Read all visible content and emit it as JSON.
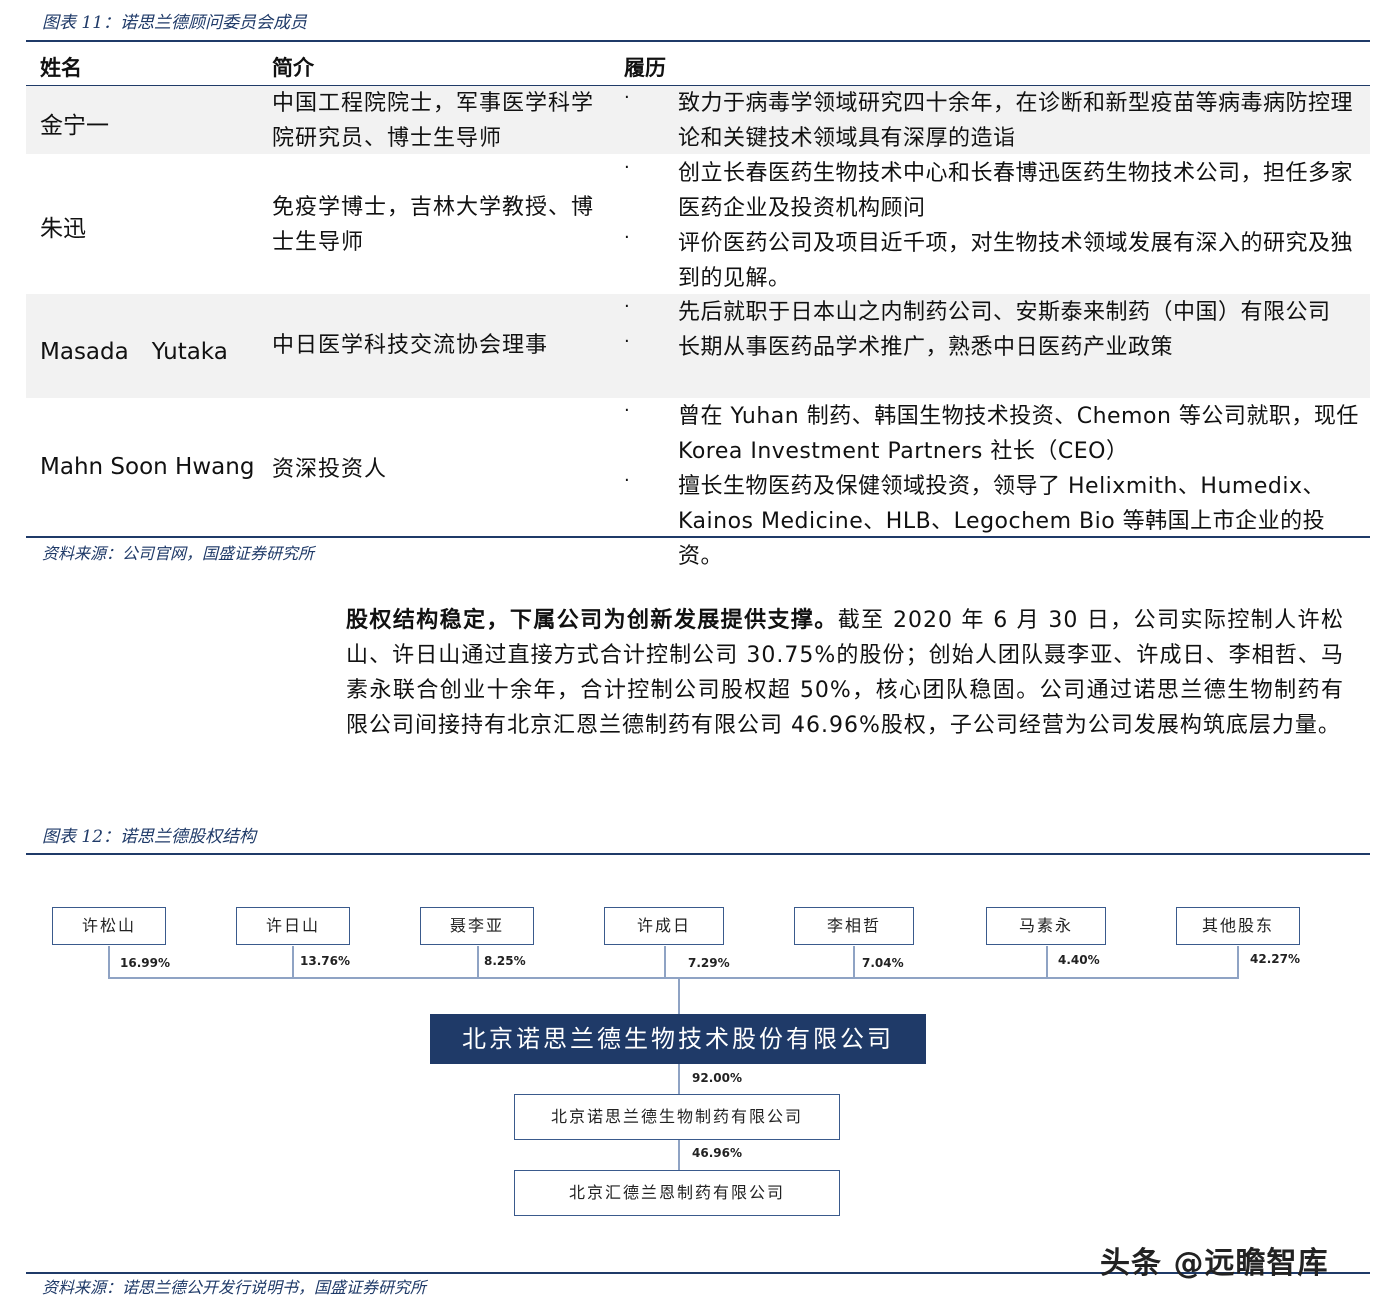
{
  "figure11": {
    "title": "图表 11：诺思兰德顾问委员会成员",
    "headers": {
      "name": "姓名",
      "intro": "简介",
      "cv": "履历"
    },
    "rows": [
      {
        "name": "金宁一",
        "intro": "中国工程院院士，军事医学科学院研究员、博士生导师",
        "cv": [
          "致力于病毒学领域研究四十余年，在诊断和新型疫苗等病毒病防控理论和关键技术领域具有深厚的造诣"
        ]
      },
      {
        "name": "朱迅",
        "intro": "免疫学博士，吉林大学教授、博士生导师",
        "cv": [
          "创立长春医药生物技术中心和长春博迅医药生物技术公司，担任多家医药企业及投资机构顾问",
          "评价医药公司及项目近千项，对生物技术领域发展有深入的研究及独到的见解。"
        ]
      },
      {
        "name": "Masada　Yutaka",
        "intro": "中日医学科技交流协会理事",
        "cv": [
          "先后就职于日本山之内制药公司、安斯泰来制药（中国）有限公司",
          "长期从事医药品学术推广，熟悉中日医药产业政策"
        ]
      },
      {
        "name": "Mahn Soon Hwang",
        "intro": "资深投资人",
        "cv": [
          "曾在 Yuhan 制药、韩国生物技术投资、Chemon 等公司就职，现任 Korea Investment Partners 社长（CEO）",
          "擅长生物医药及保健领域投资，领导了 Helixmith、Humedix、Kainos Medicine、HLB、Legochem Bio 等韩国上市企业的投资。"
        ]
      }
    ],
    "bullet": "·",
    "source": "资料来源：公司官网，国盛证券研究所"
  },
  "paragraph": {
    "lead": "股权结构稳定，下属公司为创新发展提供支撑。",
    "body": "截至 2020 年 6 月 30 日，公司实际控制人许松山、许日山通过直接方式合计控制公司 30.75%的股份；创始人团队聂李亚、许成日、李相哲、马素永联合创业十余年，合计控制公司股权超 50%，核心团队稳固。公司通过诺思兰德生物制药有限公司间接持有北京汇恩兰德制药有限公司 46.96%股权，子公司经营为公司发展构筑底层力量。"
  },
  "figure12": {
    "title": "图表 12：诺思兰德股权结构",
    "shareholders": [
      {
        "name": "许松山",
        "pct": "16.99%"
      },
      {
        "name": "许日山",
        "pct": "13.76%"
      },
      {
        "name": "聂李亚",
        "pct": "8.25%"
      },
      {
        "name": "许成日",
        "pct": "7.29%"
      },
      {
        "name": "李相哲",
        "pct": "7.04%"
      },
      {
        "name": "马素永",
        "pct": "4.40%"
      },
      {
        "name": "其他股东",
        "pct": "42.27%"
      }
    ],
    "company": "北京诺思兰德生物技术股份有限公司",
    "sub1_pct": "92.00%",
    "sub1": "北京诺思兰德生物制药有限公司",
    "sub2_pct": "46.96%",
    "sub2": "北京汇德兰恩制药有限公司",
    "source": "资料来源：诺思兰德公开发行说明书，国盛证券研究所"
  },
  "watermark": "头条 @远瞻智库"
}
